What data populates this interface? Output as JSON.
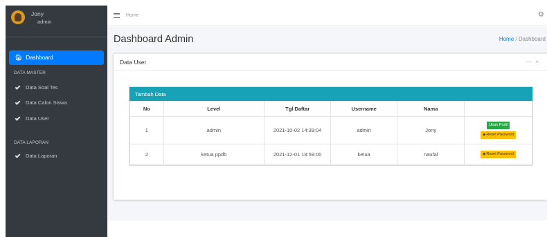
{
  "sidebar": {
    "user_name": "Jony",
    "user_role": "admin",
    "active_item": "Dashboard",
    "header_master": "DATA MASTER",
    "items_master": [
      "Data Soal Tes",
      "Data Calon Siswa",
      "Data User"
    ],
    "header_laporan": "DATA LAPORAN",
    "items_laporan": [
      "Data Laporan"
    ]
  },
  "topbar": {
    "home": "Home",
    "gear_icon": "gear-icon"
  },
  "page": {
    "title": "Dashboard Admin",
    "breadcrumb_home": "Home",
    "breadcrumb_sep": "/",
    "breadcrumb_current": "Dashboard"
  },
  "card": {
    "title": "Data User",
    "minimize": "—",
    "close": "×",
    "table_title": "Tambah Data",
    "columns": [
      "No",
      "Level",
      "Tgl Daftar",
      "Username",
      "Nama",
      ""
    ],
    "rows": [
      {
        "no": "1",
        "level": "admin",
        "tgl": "2021-10-02 14:39:04",
        "username": "admin",
        "nama": "Jony"
      },
      {
        "no": "2",
        "level": "ketua ppdb",
        "tgl": "2021-12-01 18:59:00",
        "username": "ketua",
        "nama": "naufal"
      }
    ],
    "btn_edit": "Ubah Profil",
    "btn_reset": "Reset Password"
  },
  "colors": {
    "sidebar": "#343a40",
    "active": "#007bff",
    "table_header": "#17a2b8",
    "edit_btn": "#28a745",
    "reset_btn": "#ffc107"
  }
}
